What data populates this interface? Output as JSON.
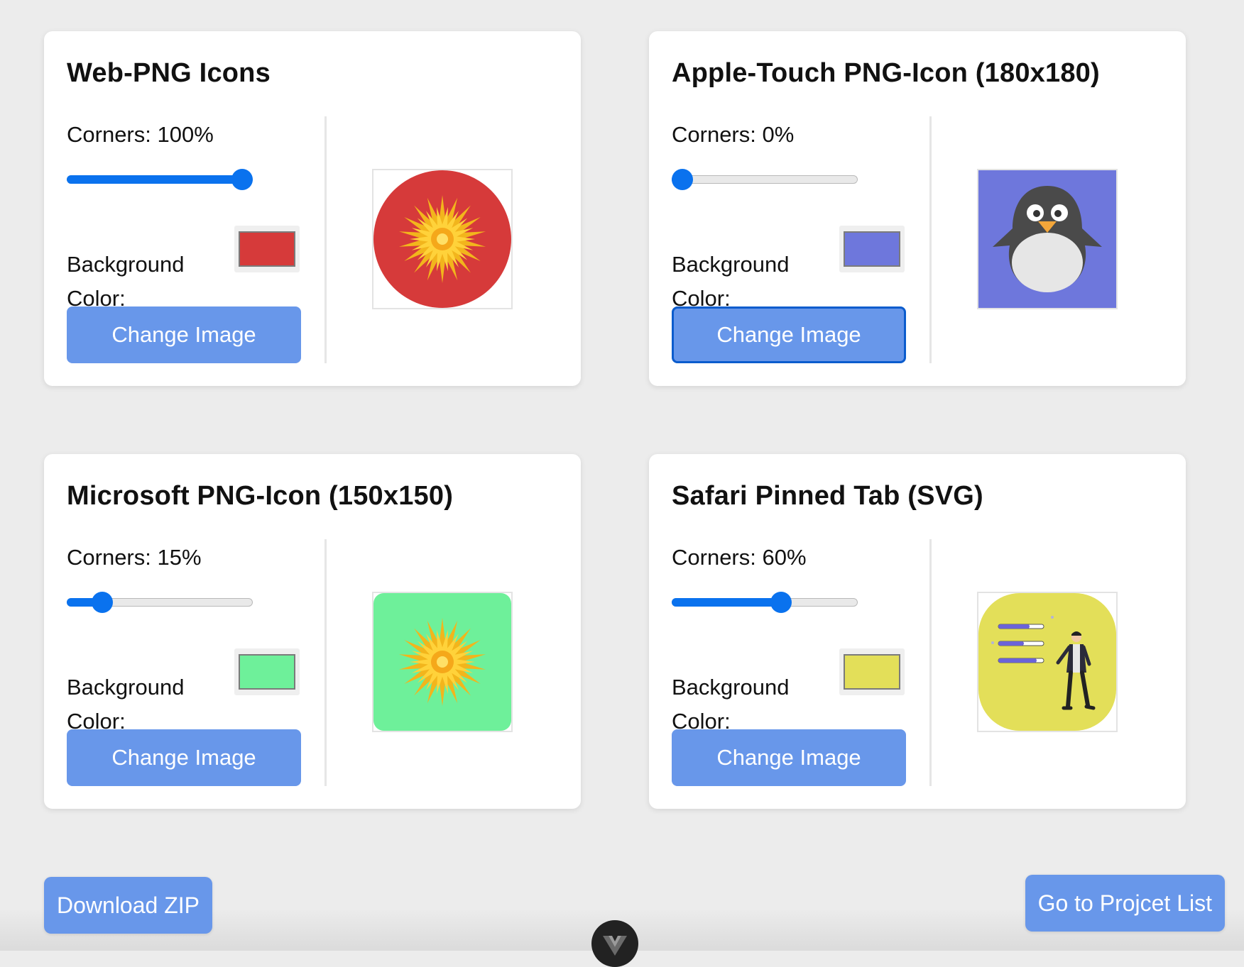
{
  "cards": [
    {
      "title": "Web-PNG Icons",
      "corners_label": "Corners: 100%",
      "corners_percent": 100,
      "background_label": "Background Color:",
      "background_color": "#d63a3a",
      "change_label": "Change Image",
      "preview_image": "sun-icon"
    },
    {
      "title": "Apple-Touch PNG-Icon (180x180)",
      "corners_label": "Corners: 0%",
      "corners_percent": 0,
      "background_label": "Background Color:",
      "background_color": "#6e77dc",
      "change_label": "Change Image",
      "preview_image": "penguin-icon"
    },
    {
      "title": "Microsoft PNG-Icon (150x150)",
      "corners_label": "Corners: 15%",
      "corners_percent": 15,
      "background_label": "Background Color:",
      "background_color": "#6ef09a",
      "change_label": "Change Image",
      "preview_image": "sun-icon"
    },
    {
      "title": "Safari Pinned Tab (SVG)",
      "corners_label": "Corners: 60%",
      "corners_percent": 60,
      "background_label": "Background Color:",
      "background_color": "#e3df59",
      "change_label": "Change Image",
      "preview_image": "checklist-person-illustration"
    }
  ],
  "footer": {
    "download_label": "Download ZIP",
    "project_list_label": "Go to Projcet List"
  },
  "colors": {
    "accent": "#0a72ee",
    "button": "#6897ea"
  }
}
